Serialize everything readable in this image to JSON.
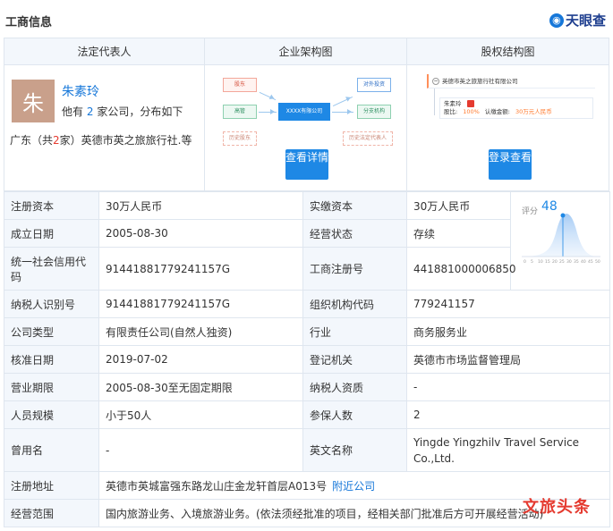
{
  "header": {
    "title": "工商信息",
    "brand": "天眼查"
  },
  "top": {
    "legal_rep": {
      "heading": "法定代表人",
      "avatar_char": "朱",
      "name": "朱素玲",
      "desc_prefix": "他有",
      "desc_count": "2",
      "desc_suffix": "家公司，分布如下",
      "region_prefix": "广东（共",
      "region_count": "2",
      "region_suffix": "家）英德市英之旅旅行社.等"
    },
    "org_chart": {
      "heading": "企业架构图",
      "node_shareholder": "股东",
      "node_exec": "高管",
      "node_history_sh": "历史股东",
      "node_company": "XXXX有限公司",
      "node_investment": "对外投资",
      "node_branch": "分支机构",
      "node_history_rep": "历史法定代表人",
      "button": "查看详情"
    },
    "equity": {
      "heading": "股权结构图",
      "root_company": "英德市英之旅旅行社有限公司",
      "holder_name": "朱素玲",
      "ratio_label": "股比:",
      "ratio_value": "100%",
      "amount_label": "认缴金额:",
      "amount_value": "30万元人民币",
      "button": "登录查看"
    }
  },
  "score": {
    "label": "评分",
    "value": "48"
  },
  "rows": [
    {
      "l1": "注册资本",
      "v1": "30万人民币",
      "l2": "实缴资本",
      "v2": "30万人民币"
    },
    {
      "l1": "成立日期",
      "v1": "2005-08-30",
      "l2": "经营状态",
      "v2": "存续"
    },
    {
      "l1": "统一社会信用代码",
      "v1": "91441881779241157G",
      "l2": "工商注册号",
      "v2": "441881000006850"
    },
    {
      "l1": "纳税人识别号",
      "v1": "91441881779241157G",
      "l2": "组织机构代码",
      "v2": "779241157"
    },
    {
      "l1": "公司类型",
      "v1": "有限责任公司(自然人独资)",
      "l2": "行业",
      "v2": "商务服务业"
    },
    {
      "l1": "核准日期",
      "v1": "2019-07-02",
      "l2": "登记机关",
      "v2": "英德市市场监督管理局"
    },
    {
      "l1": "营业期限",
      "v1": "2005-08-30至无固定期限",
      "l2": "纳税人资质",
      "v2": "-"
    },
    {
      "l1": "人员规模",
      "v1": "小于50人",
      "l2": "参保人数",
      "v2": "2"
    },
    {
      "l1": "曾用名",
      "v1": "-",
      "l2": "英文名称",
      "v2": "Yingde Yingzhilv Travel Service Co.,Ltd."
    }
  ],
  "address": {
    "label": "注册地址",
    "value": "英德市英城富强东路龙山庄金龙轩首层A013号",
    "link": "附近公司"
  },
  "scope": {
    "label": "经营范围",
    "value": "国内旅游业务、入境旅游业务。(依法须经批准的项目，经相关部门批准后方可开展经营活动)"
  },
  "watermark": "文旅头条",
  "colors": {
    "accent": "#1e88e5",
    "link": "#1677d9",
    "header_bg": "#f3f7fc",
    "border": "#dfe6ef"
  }
}
